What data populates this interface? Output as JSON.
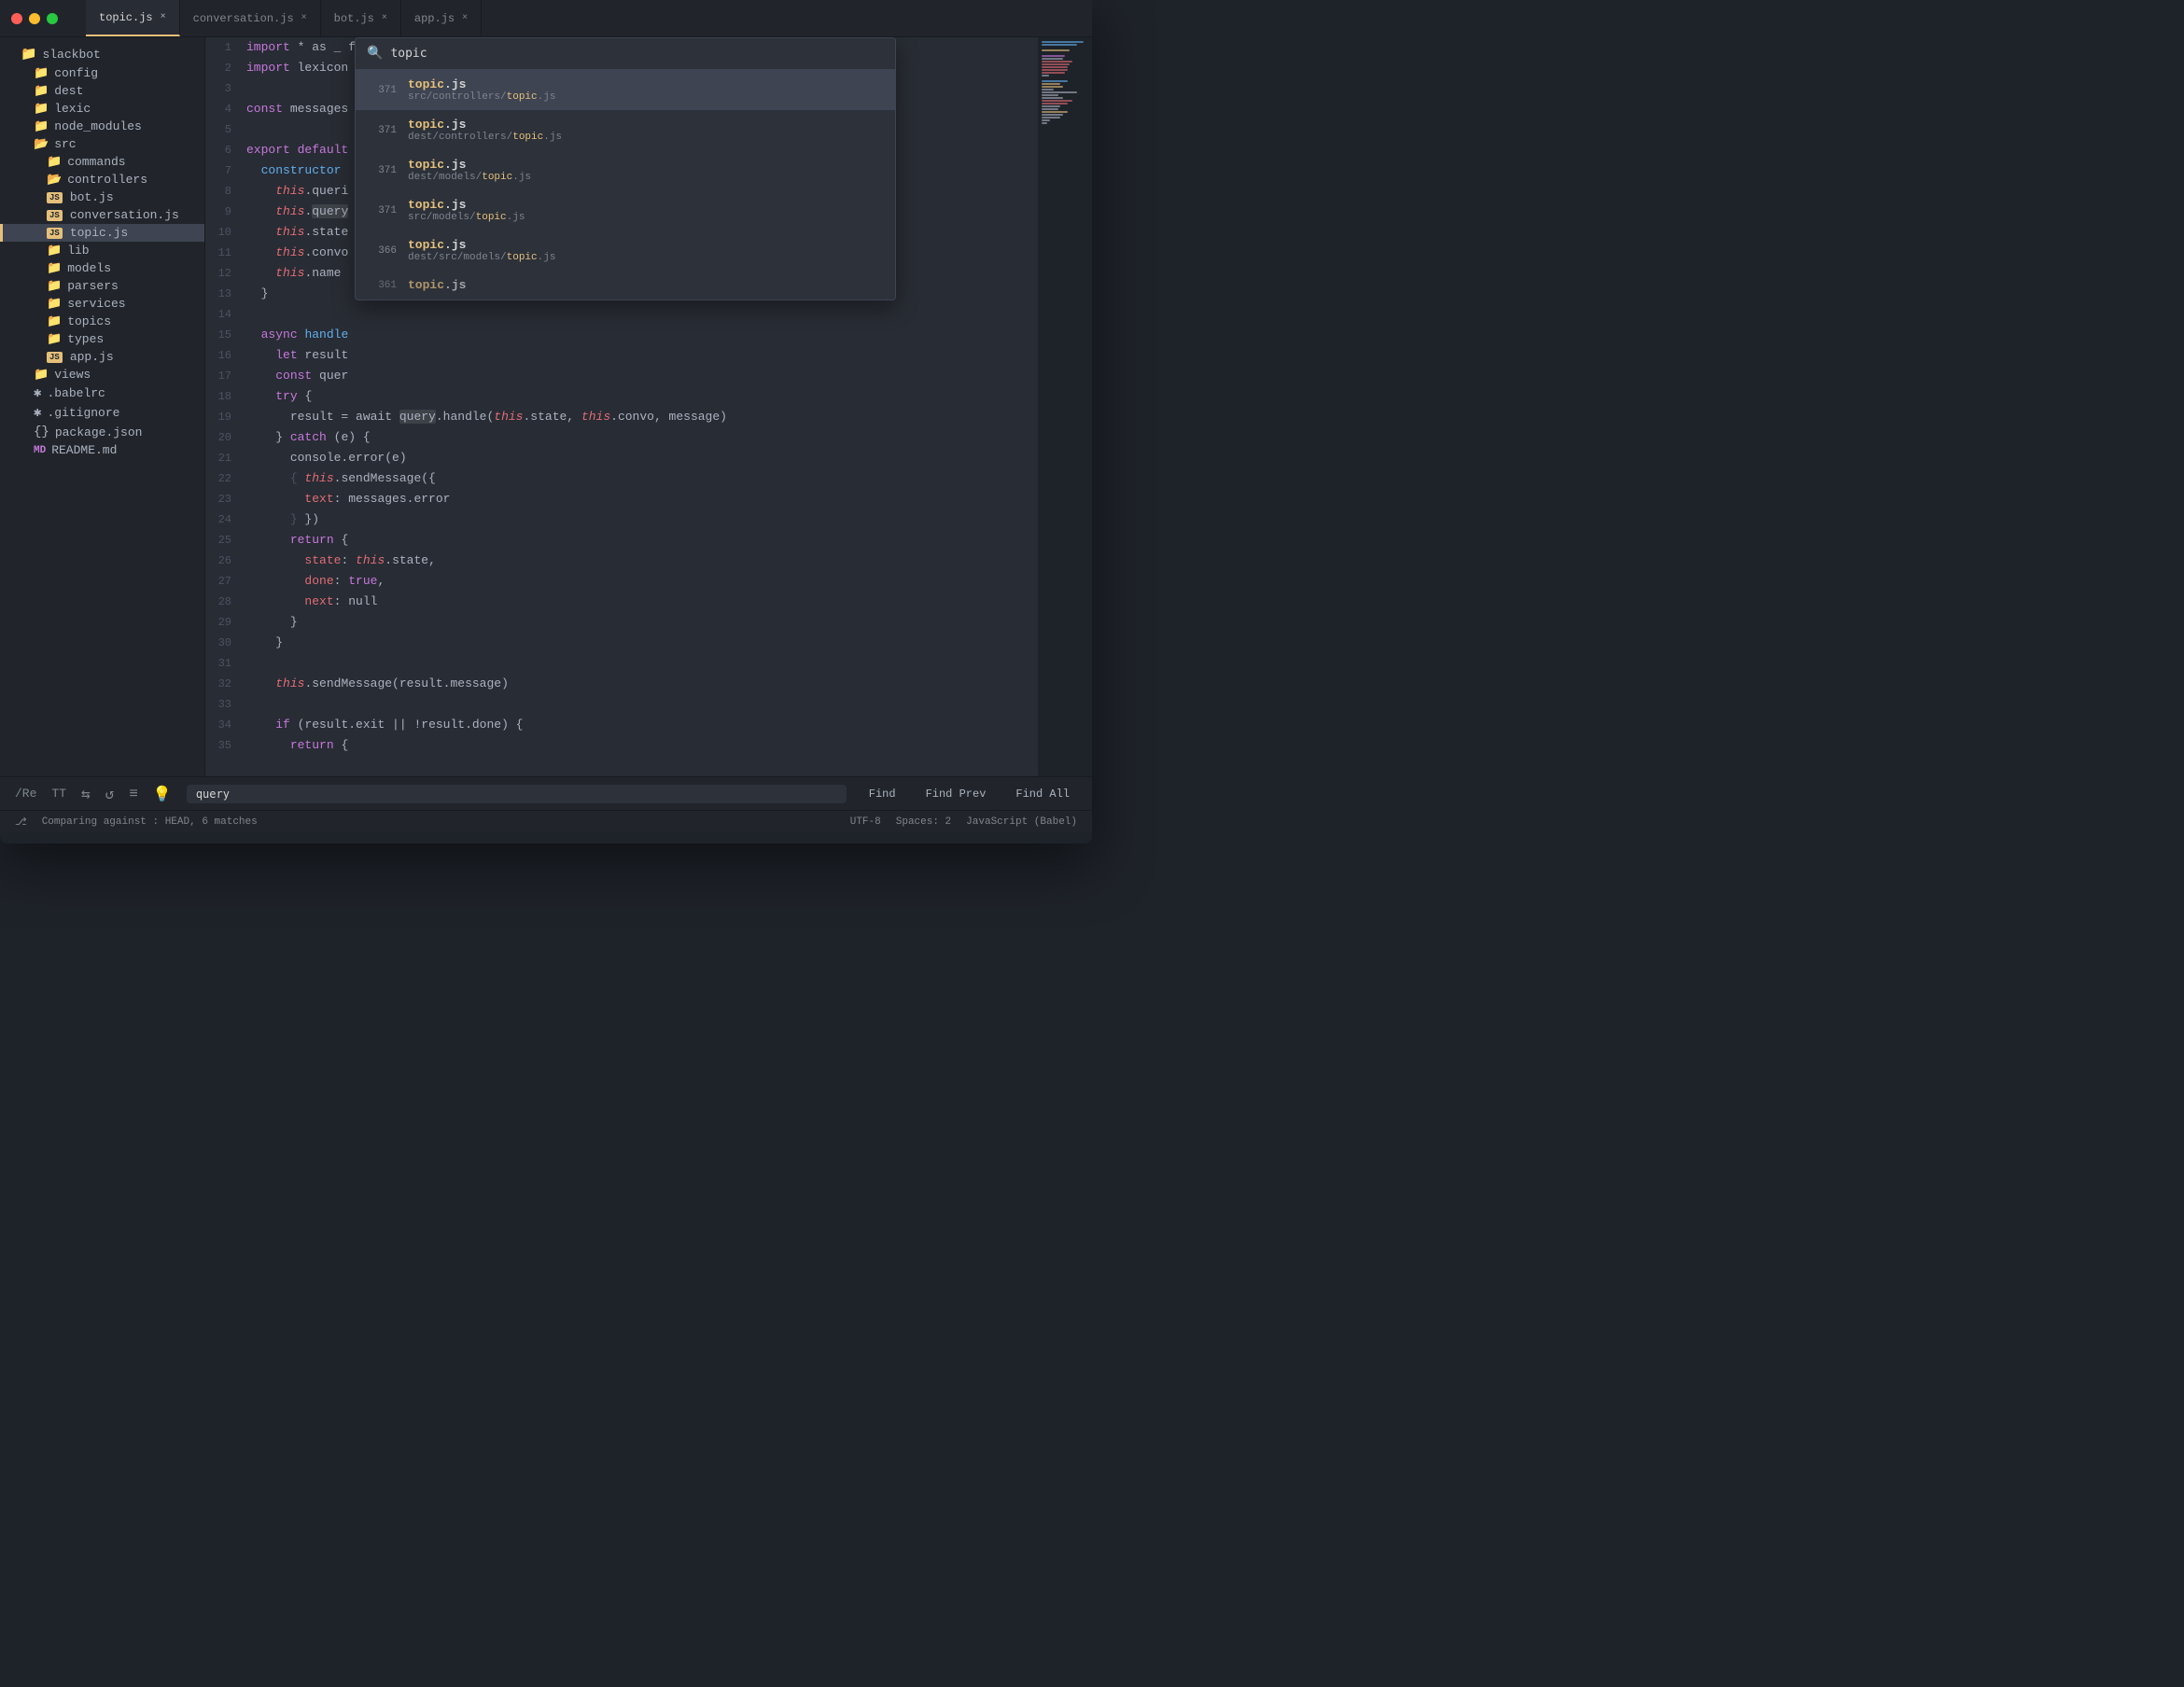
{
  "titlebar": {
    "dots": [
      "red",
      "yellow",
      "green"
    ],
    "tabs": [
      {
        "label": "topic.js",
        "active": true,
        "close": "×"
      },
      {
        "label": "conversation.js",
        "active": false,
        "close": "×"
      },
      {
        "label": "bot.js",
        "active": false,
        "close": "×"
      },
      {
        "label": "app.js",
        "active": false,
        "close": "×"
      }
    ]
  },
  "sidebar": {
    "root": "slackbot",
    "items": [
      {
        "label": "config",
        "type": "folder",
        "indent": 1
      },
      {
        "label": "dest",
        "type": "folder",
        "indent": 1
      },
      {
        "label": "lexic",
        "type": "folder",
        "indent": 1
      },
      {
        "label": "node_modules",
        "type": "folder",
        "indent": 1
      },
      {
        "label": "src",
        "type": "folder-open",
        "indent": 1
      },
      {
        "label": "commands",
        "type": "folder",
        "indent": 2
      },
      {
        "label": "controllers",
        "type": "folder-open",
        "indent": 2
      },
      {
        "label": "bot.js",
        "type": "js",
        "indent": 3
      },
      {
        "label": "conversation.js",
        "type": "js",
        "indent": 3
      },
      {
        "label": "topic.js",
        "type": "js",
        "indent": 3,
        "active": true
      },
      {
        "label": "lib",
        "type": "folder",
        "indent": 2
      },
      {
        "label": "models",
        "type": "folder",
        "indent": 2
      },
      {
        "label": "parsers",
        "type": "folder",
        "indent": 2
      },
      {
        "label": "services",
        "type": "folder",
        "indent": 2
      },
      {
        "label": "topics",
        "type": "folder",
        "indent": 2
      },
      {
        "label": "types",
        "type": "folder",
        "indent": 2
      },
      {
        "label": "app.js",
        "type": "js",
        "indent": 2
      },
      {
        "label": "views",
        "type": "folder",
        "indent": 1
      },
      {
        "label": ".babelrc",
        "type": "asterisk",
        "indent": 1
      },
      {
        "label": ".gitignore",
        "type": "asterisk",
        "indent": 1
      },
      {
        "label": "package.json",
        "type": "curly",
        "indent": 1
      },
      {
        "label": "README.md",
        "type": "md",
        "indent": 1
      }
    ]
  },
  "search": {
    "placeholder": "topic",
    "query": "topic",
    "results": [
      {
        "line": 371,
        "filename": "topic.js",
        "match_in_name": "topic",
        "path": "src/controllers/topic.js",
        "match_in_path": "topic",
        "selected": true
      },
      {
        "line": 371,
        "filename": "topic.js",
        "match_in_name": "topic",
        "path": "dest/controllers/topic.js",
        "match_in_path": "topic"
      },
      {
        "line": 371,
        "filename": "topic.js",
        "match_in_name": "topic",
        "path": "dest/models/topic.js",
        "match_in_path": "topic"
      },
      {
        "line": 371,
        "filename": "topic.js",
        "match_in_name": "topic",
        "path": "src/models/topic.js",
        "match_in_path": "topic"
      },
      {
        "line": 366,
        "filename": "topic.js",
        "match_in_name": "topic",
        "path": "dest/src/models/topic.js",
        "match_in_path": "topic"
      },
      {
        "line": 361,
        "filename": "topic.js",
        "match_in_name": "topic",
        "path": "...",
        "match_in_path": "topic"
      }
    ]
  },
  "code": {
    "lines": [
      {
        "num": 1,
        "content": "import * as _ from 'lodash'"
      },
      {
        "num": 2,
        "content": "import lexicon from 'lib/lexicon'"
      },
      {
        "num": 3,
        "content": ""
      },
      {
        "num": 4,
        "content": "const messages"
      },
      {
        "num": 5,
        "content": ""
      },
      {
        "num": 6,
        "content": "export default"
      },
      {
        "num": 7,
        "content": "  constructor"
      },
      {
        "num": 8,
        "content": "    this.queri"
      },
      {
        "num": 9,
        "content": "    this.query"
      },
      {
        "num": 10,
        "content": "    this.state"
      },
      {
        "num": 11,
        "content": "    this.convo"
      },
      {
        "num": 12,
        "content": "    this.name"
      },
      {
        "num": 13,
        "content": "  }"
      },
      {
        "num": 14,
        "content": ""
      },
      {
        "num": 15,
        "content": "  async handle"
      },
      {
        "num": 16,
        "content": "    let result"
      },
      {
        "num": 17,
        "content": "    const quer"
      },
      {
        "num": 18,
        "content": "    try {"
      },
      {
        "num": 19,
        "content": "      result = await query.handle(this.state, this.convo, message)"
      },
      {
        "num": 20,
        "content": "    } catch (e) {"
      },
      {
        "num": 21,
        "content": "      console.error(e)"
      },
      {
        "num": 22,
        "content": "      this.sendMessage({"
      },
      {
        "num": 23,
        "content": "        text: messages.error"
      },
      {
        "num": 24,
        "content": "      })"
      },
      {
        "num": 25,
        "content": "      return {"
      },
      {
        "num": 26,
        "content": "        state: this.state,"
      },
      {
        "num": 27,
        "content": "        done: true,"
      },
      {
        "num": 28,
        "content": "        next: null"
      },
      {
        "num": 29,
        "content": "      }"
      },
      {
        "num": 30,
        "content": "    }"
      },
      {
        "num": 31,
        "content": ""
      },
      {
        "num": 32,
        "content": "    this.sendMessage(result.message)"
      },
      {
        "num": 33,
        "content": ""
      },
      {
        "num": 34,
        "content": "    if (result.exit || !result.done) {"
      },
      {
        "num": 35,
        "content": "      return {"
      }
    ]
  },
  "toolbar": {
    "regex_label": "/Re",
    "case_label": "TT",
    "arrows_label": "⇆",
    "refresh_label": "↺",
    "list_label": "≡",
    "bulb_label": "💡",
    "find_value": "query",
    "find_label": "Find",
    "find_prev_label": "Find Prev",
    "find_all_label": "Find All"
  },
  "statusbar": {
    "git_label": "⎇ Comparing against : HEAD, 6 matches",
    "encoding": "UTF-8",
    "spaces": "Spaces: 2",
    "language": "JavaScript (Babel)"
  }
}
